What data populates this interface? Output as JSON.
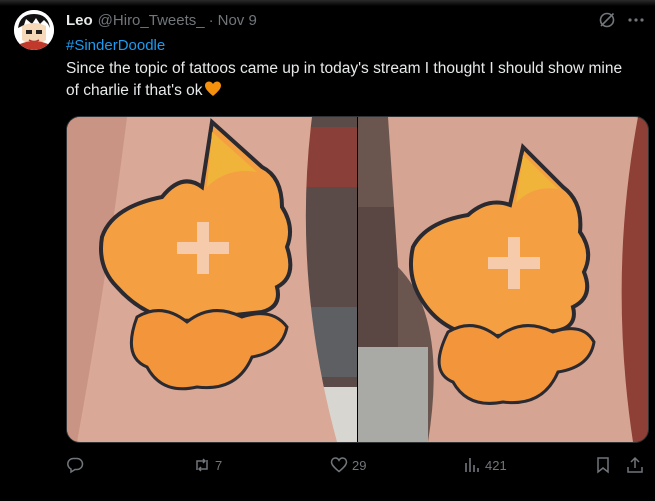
{
  "tweet": {
    "author_name": "Leo",
    "handle": "@Hiro_Tweets_",
    "separator": "·",
    "date": "Nov 9",
    "hashtag": "#SinderDoodle",
    "text": "Since the topic of tattoos came up in today's stream I thought I should show mine of charlie if that's ok",
    "emoji": "orange-heart-icon"
  },
  "actions": {
    "reply_count": "",
    "retweet_count": "7",
    "like_count": "29",
    "view_count": "421"
  },
  "colors": {
    "background": "#000000",
    "text": "#e7e9ea",
    "muted": "#71767b",
    "link": "#1d9bf0",
    "heart": "#f4900c"
  }
}
